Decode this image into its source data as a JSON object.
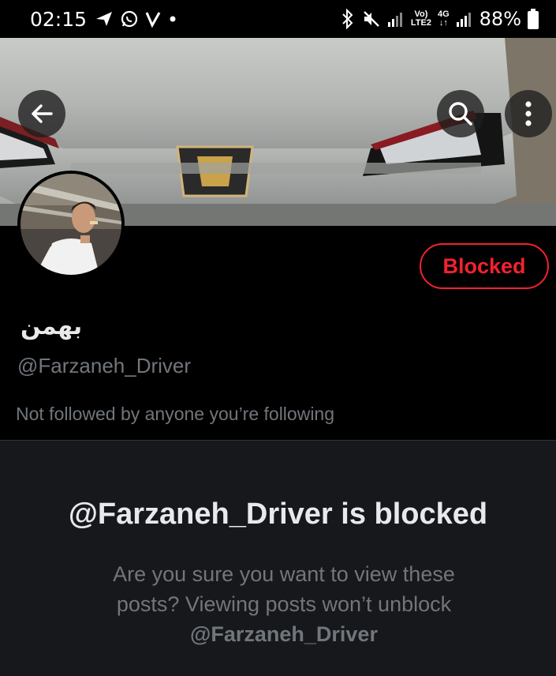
{
  "status_bar": {
    "time": "02:15",
    "battery": "88%",
    "network_top": "Vo)",
    "network_bottom": "LTE2",
    "net_type": "4G",
    "icons": [
      "send-icon",
      "whatsapp-icon",
      "v-icon",
      "dot-icon",
      "bluetooth-icon",
      "mute-icon",
      "signal-icon",
      "signal-icon",
      "battery-icon"
    ]
  },
  "header": {
    "back_icon": "arrow-left-icon",
    "search_icon": "search-icon",
    "more_icon": "more-vertical-icon"
  },
  "profile": {
    "display_name": "بهمن",
    "handle": "@Farzaneh_Driver",
    "follow_note": "Not followed by anyone you’re following",
    "blocked_button_label": "Blocked"
  },
  "blocked_notice": {
    "title": "@Farzaneh_Driver is blocked",
    "body": "Are you sure you want to view these posts? Viewing posts won’t unblock",
    "handle": "@Farzaneh_Driver"
  },
  "colors": {
    "blocked_red": "#f4212e",
    "secondary_text": "#71767b",
    "panel_bg": "#16181c"
  }
}
